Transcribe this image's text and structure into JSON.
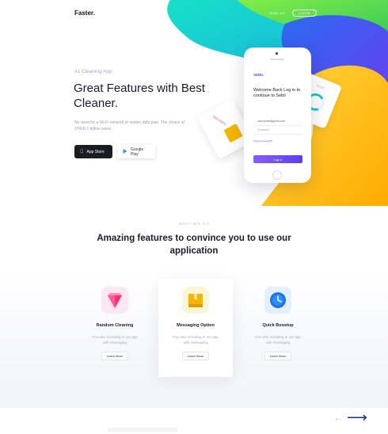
{
  "nav": {
    "logo": "Faster.",
    "link_label": "SIGN UP",
    "button_label": "LOGIN"
  },
  "hero": {
    "eyebrow": "#1 Cleaning App",
    "title": "Great Features with Best Cleaner.",
    "description": "No need for a Wi-Fi network or mobile data plan. The choice of OVER 1 billion users.",
    "app_store_label": "App Store",
    "google_play_label": "Google Play"
  },
  "phone": {
    "brand": "SEBIL",
    "welcome": "Welcome Back Log in to continue to Sebil",
    "email_value": "username@gmail.com",
    "password_placeholder": "Password",
    "forgot_label": "Forgot password?",
    "login_label": "Log in"
  },
  "cards": {
    "left_label": "Messaging",
    "right_label": "Boost"
  },
  "section": {
    "eyebrow": "WHAT WE DO",
    "title": "Amazing features to convince you to use our application"
  },
  "features": [
    {
      "title": "Random Cleaning",
      "description": "Fun also including in our app with messaging",
      "button_label": "Learn More",
      "icon": "gem-icon",
      "icon_color": "#ff2e7a"
    },
    {
      "title": "Messaging Option",
      "description": "Fun also including in our app with messaging",
      "button_label": "Learn More",
      "icon": "box-icon",
      "icon_color": "#f7b400"
    },
    {
      "title": "Quick Boostup",
      "description": "Fun also including in our app with messaging",
      "button_label": "Learn More",
      "icon": "clock-icon",
      "icon_color": "#1e73e8"
    }
  ],
  "carousel": {
    "prev_icon": "arrow-left-icon",
    "next_icon": "arrow-right-icon"
  },
  "colors": {
    "accent_purple": "#6a4df4",
    "blob_cyan": "#18d2d8",
    "blob_blue": "#2196f3",
    "blob_yellow": "#ffc107",
    "blob_green": "#64dd17",
    "dark_text": "#1b1b2e"
  }
}
